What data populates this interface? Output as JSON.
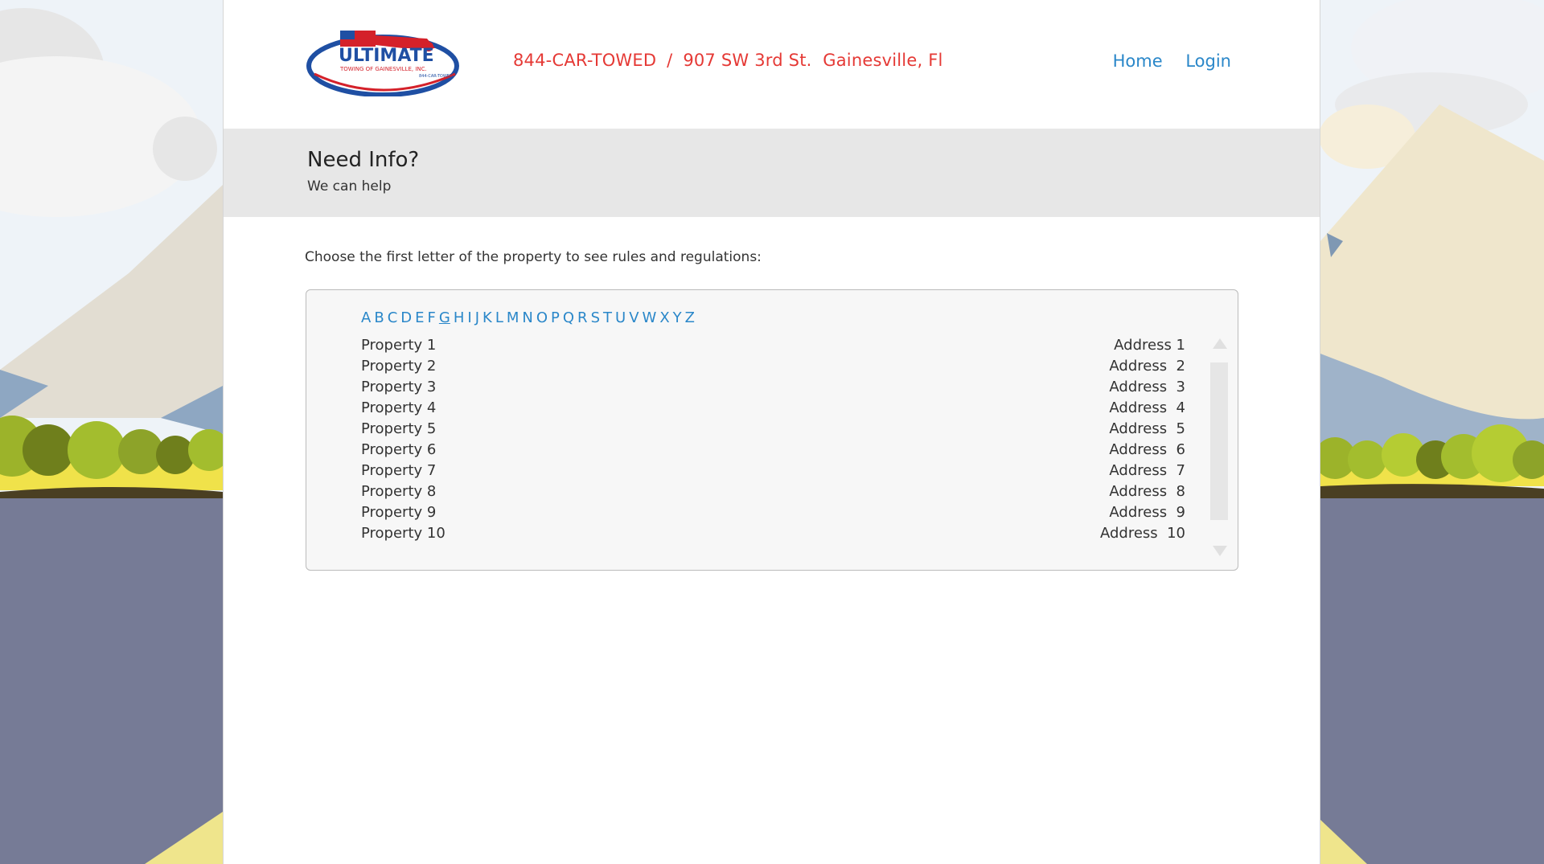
{
  "header": {
    "logo_alt": "Ultimate Towing of Gainesville, Inc. logo",
    "phone": "844-CAR-TOWED",
    "separator": "/",
    "address": "907 SW 3rd St.  Gainesville, Fl",
    "nav": [
      {
        "label": "Home"
      },
      {
        "label": "Login"
      }
    ]
  },
  "logo": {
    "line1": "ULTIMATE",
    "line2": "TOWING OF GAINESVILLE, INC.",
    "line3": "844-CAR-TOWED"
  },
  "banner": {
    "title": "Need Info?",
    "subtitle": "We can help"
  },
  "intro": "Choose the first letter of the property to see rules and regulations:",
  "letters": [
    "A",
    "B",
    "C",
    "D",
    "E",
    "F",
    "G",
    "H",
    "I",
    "J",
    "K",
    "L",
    "M",
    "N",
    "O",
    "P",
    "Q",
    "R",
    "S",
    "T",
    "U",
    "V",
    "W",
    "X",
    "Y",
    "Z"
  ],
  "active_letter": "G",
  "properties": [
    {
      "name": "Property 1",
      "address": "Address 1"
    },
    {
      "name": "Property 2",
      "address": "Address  2"
    },
    {
      "name": "Property 3",
      "address": "Address  3"
    },
    {
      "name": "Property 4",
      "address": "Address  4"
    },
    {
      "name": "Property 5",
      "address": "Address  5"
    },
    {
      "name": "Property 6",
      "address": "Address  6"
    },
    {
      "name": "Property 7",
      "address": "Address  7"
    },
    {
      "name": "Property 8",
      "address": "Address  8"
    },
    {
      "name": "Property 9",
      "address": "Address  9"
    },
    {
      "name": "Property 10",
      "address": "Address  10"
    }
  ],
  "colors": {
    "accent_red": "#e53935",
    "link_blue": "#2a87c9",
    "banner_gray": "#e7e7e7"
  }
}
